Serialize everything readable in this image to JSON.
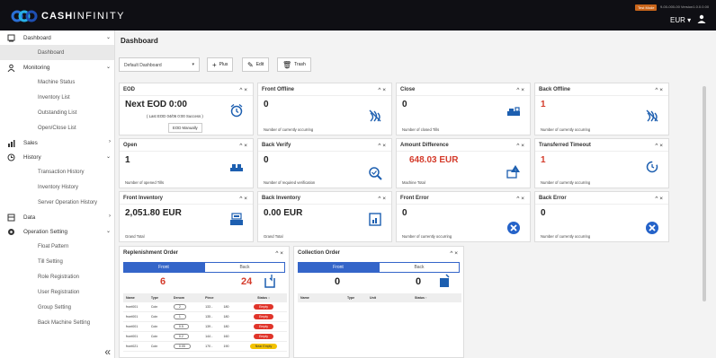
{
  "brand": {
    "logo_text_bold": "CASH",
    "logo_text": "INFINITY"
  },
  "topbar": {
    "test_mode": "Test Mode",
    "version_info": "9-00-000-00  Version1.0.0.0.00",
    "currency": "EUR ▾"
  },
  "sidebar": {
    "items": [
      {
        "type": "group",
        "label": "Dashboard",
        "icon": "dashboard-icon",
        "chevron": "⌄"
      },
      {
        "type": "sub",
        "label": "Dashboard",
        "active": true
      },
      {
        "type": "group",
        "label": "Monitoring",
        "icon": "monitoring-icon",
        "chevron": "⌄"
      },
      {
        "type": "sub",
        "label": "Machine Status"
      },
      {
        "type": "sub",
        "label": "Inventory List"
      },
      {
        "type": "sub",
        "label": "Outstanding List"
      },
      {
        "type": "sub",
        "label": "Open/Close List"
      },
      {
        "type": "group",
        "label": "Sales",
        "icon": "sales-icon",
        "chevron": "›"
      },
      {
        "type": "group",
        "label": "History",
        "icon": "history-icon",
        "chevron": "⌄"
      },
      {
        "type": "sub",
        "label": "Transaction History"
      },
      {
        "type": "sub",
        "label": "Inventory History"
      },
      {
        "type": "sub",
        "label": "Server Operation History"
      },
      {
        "type": "group",
        "label": "Data",
        "icon": "data-icon",
        "chevron": "›"
      },
      {
        "type": "group",
        "label": "Operation Setting",
        "icon": "gear-icon",
        "chevron": "⌄"
      },
      {
        "type": "sub",
        "label": "Float Pattern"
      },
      {
        "type": "sub",
        "label": "Till Setting"
      },
      {
        "type": "sub",
        "label": "Role Registration"
      },
      {
        "type": "sub",
        "label": "User Registration"
      },
      {
        "type": "sub",
        "label": "Group Setting"
      },
      {
        "type": "sub",
        "label": "Back Machine Setting"
      }
    ],
    "collapse": "«"
  },
  "main": {
    "title": "Dashboard",
    "dashboard_select": "Default Dashboard",
    "select_caret": "▾",
    "buttons": {
      "plus": "Plus",
      "edit": "Edit",
      "trash": "Trash"
    },
    "controls": "^ ×"
  },
  "widgets": {
    "eod": {
      "title": "EOD",
      "value": "Next EOD 0:00",
      "sub": "( Last EOD 04/06 0:00 Success )",
      "button": "EOD Manually"
    },
    "front_offline": {
      "title": "Front Offline",
      "value": "0",
      "footer": "Number of currently occurring"
    },
    "close": {
      "title": "Close",
      "value": "0",
      "footer": "Number of closed Tills"
    },
    "back_offline": {
      "title": "Back Offline",
      "value": "1",
      "footer": "Number of currently occurring"
    },
    "open": {
      "title": "Open",
      "value": "1",
      "footer": "Number of opened Tills"
    },
    "back_verify": {
      "title": "Back Verify",
      "value": "0",
      "footer": "Number of required verification"
    },
    "amount_difference": {
      "title": "Amount Difference",
      "value": "648.03 EUR",
      "footer": "Machine Total"
    },
    "transferred_timeout": {
      "title": "Transferred Timeout",
      "value": "1",
      "footer": "Number of currently occurring"
    },
    "front_inventory": {
      "title": "Front Inventory",
      "value": "2,051.80 EUR",
      "footer": "Grand Total"
    },
    "back_inventory": {
      "title": "Back Inventory",
      "value": "0.00 EUR",
      "footer": "Grand Total"
    },
    "front_error": {
      "title": "Front Error",
      "value": "0",
      "footer": "Number of currently occurring"
    },
    "back_error": {
      "title": "Back Error",
      "value": "0",
      "footer": "Number of currently occurring"
    }
  },
  "replenishment": {
    "title": "Replenishment Order",
    "tab_front": "Front",
    "tab_back": "Back",
    "front_count": "6",
    "back_count": "24",
    "headers": [
      "Name",
      "Type",
      "Denom",
      "Piece",
      "",
      "Status ↕"
    ],
    "rows": [
      {
        "name": "front001",
        "type": "Coin",
        "denom": "2",
        "piece": "133 -",
        "max": "180",
        "status": "Empty",
        "color": "#e0342a"
      },
      {
        "name": "front001",
        "type": "Coin",
        "denom": "1",
        "piece": "135 -",
        "max": "180",
        "status": "Empty",
        "color": "#e0342a"
      },
      {
        "name": "front001",
        "type": "Coin",
        "denom": "0.5",
        "piece": "139 -",
        "max": "180",
        "status": "Empty",
        "color": "#e0342a"
      },
      {
        "name": "front001",
        "type": "Coin",
        "denom": "0.2",
        "piece": "144 -",
        "max": "160",
        "status": "Empty",
        "color": "#e0342a"
      },
      {
        "name": "front021",
        "type": "Coin",
        "denom": "0.05",
        "piece": "170 -",
        "max": "190",
        "status": "Near Empty",
        "color": "#f2c200"
      }
    ]
  },
  "collection": {
    "title": "Collection Order",
    "tab_front": "Front",
    "tab_back": "Back",
    "front_count": "0",
    "back_count": "0",
    "headers": [
      "Name",
      "Type",
      "Unit",
      "Status ↑"
    ]
  },
  "colors": {
    "accent": "#3465c9",
    "red": "#d43b2b",
    "icon_blue": "#1d5fb0"
  }
}
